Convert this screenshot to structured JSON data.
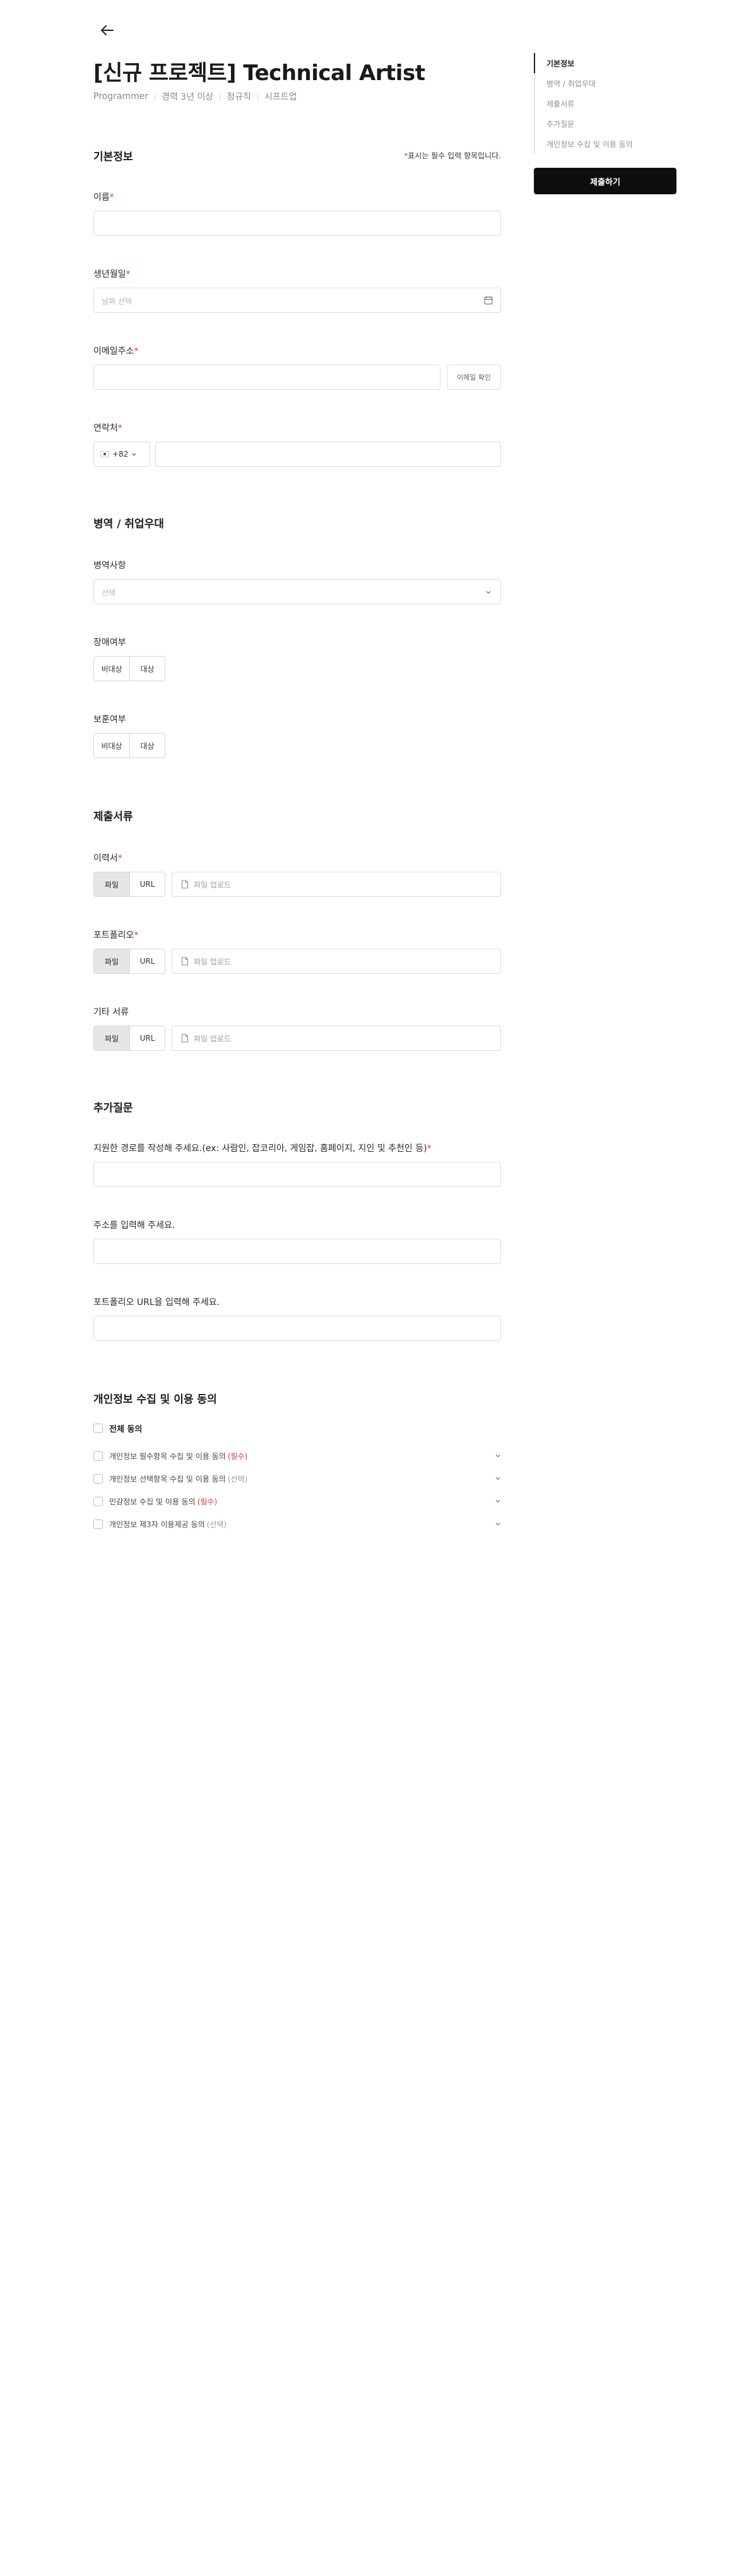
{
  "job": {
    "title": "[신규 프로젝트] Technical Artist",
    "meta": [
      "Programmer",
      "경력 3년 이상",
      "정규직",
      "시프트업"
    ]
  },
  "basic": {
    "section_title": "기본정보",
    "required_note_star": "*",
    "required_note_text": "표시는 필수 입력 항목입니다.",
    "name_label": "이름",
    "birth_label": "생년월일",
    "birth_placeholder": "날짜 선택",
    "email_label": "이메일주소",
    "email_confirm": "이메일 확인",
    "phone_label": "연락처",
    "phone_code": "+82"
  },
  "military": {
    "section_title": "병역 / 취업우대",
    "service_label": "병역사항",
    "service_placeholder": "선택",
    "disability_label": "장애여부",
    "veteran_label": "보훈여부",
    "options": [
      "비대상",
      "대상"
    ]
  },
  "documents": {
    "section_title": "제출서류",
    "resume_label": "이력서",
    "portfolio_label": "포트폴리오",
    "other_label": "기타 서류",
    "tab_file": "파일",
    "tab_url": "URL",
    "upload_placeholder": "파일 업로드"
  },
  "questions": {
    "section_title": "추가질문",
    "q1": "지원한 경로를 작성해 주세요.(ex: 사람인, 잡코리아, 게임잡, 홈페이지, 지인 및 추천인 등)",
    "q2": "주소를 입력해 주세요.",
    "q3": "포트폴리오 URL을 입력해 주세요."
  },
  "consent": {
    "section_title": "개인정보 수집 및 이용 동의",
    "all": "전체 동의",
    "items": [
      {
        "text": "개인정보 필수항목 수집 및 이용 동의",
        "tag": "(필수)"
      },
      {
        "text": "개인정보 선택항목 수집 및 이용 동의",
        "tag": "(선택)"
      },
      {
        "text": "민감정보 수집 및 이용 동의",
        "tag": "(필수)"
      },
      {
        "text": "개인정보 제3자 이용제공 동의",
        "tag": "(선택)"
      }
    ]
  },
  "sidebar": {
    "toc": [
      "기본정보",
      "병역 / 취업우대",
      "제출서류",
      "추가질문",
      "개인정보 수집 및 이용 동의"
    ],
    "submit": "제출하기"
  },
  "colors": {
    "accent": "#0e0e0e",
    "required": "#e03a3a",
    "border": "#dcdcdc"
  }
}
